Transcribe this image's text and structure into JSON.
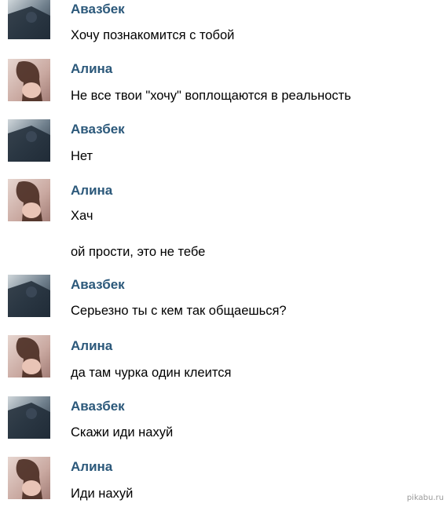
{
  "messages": [
    {
      "author": "Авазбек",
      "text": "Хочу познакомится с тобой",
      "avatar": "avazbek-avatar"
    },
    {
      "author": "Алина",
      "text": "Не все твои \"хочу\" воплощаются в реальность",
      "avatar": "alina-avatar"
    },
    {
      "author": "Авазбек",
      "text": "Нет",
      "avatar": "avazbek-avatar"
    },
    {
      "author": "Алина",
      "text": "Хач",
      "text2": "ой прости, это не тебе",
      "avatar": "alina-avatar"
    },
    {
      "author": "Авазбек",
      "text": "Серьезно ты с кем так общаешься?",
      "avatar": "avazbek-avatar"
    },
    {
      "author": "Алина",
      "text": "да там чурка один клеится",
      "avatar": "alina-avatar"
    },
    {
      "author": "Авазбек",
      "text": "Скажи иди нахуй",
      "avatar": "avazbek-avatar"
    },
    {
      "author": "Алина",
      "text": "Иди нахуй",
      "avatar": "alina-avatar"
    }
  ],
  "watermark": "pikabu.ru",
  "colors": {
    "author": "#2b587a",
    "text": "#000000",
    "background": "#ffffff"
  }
}
